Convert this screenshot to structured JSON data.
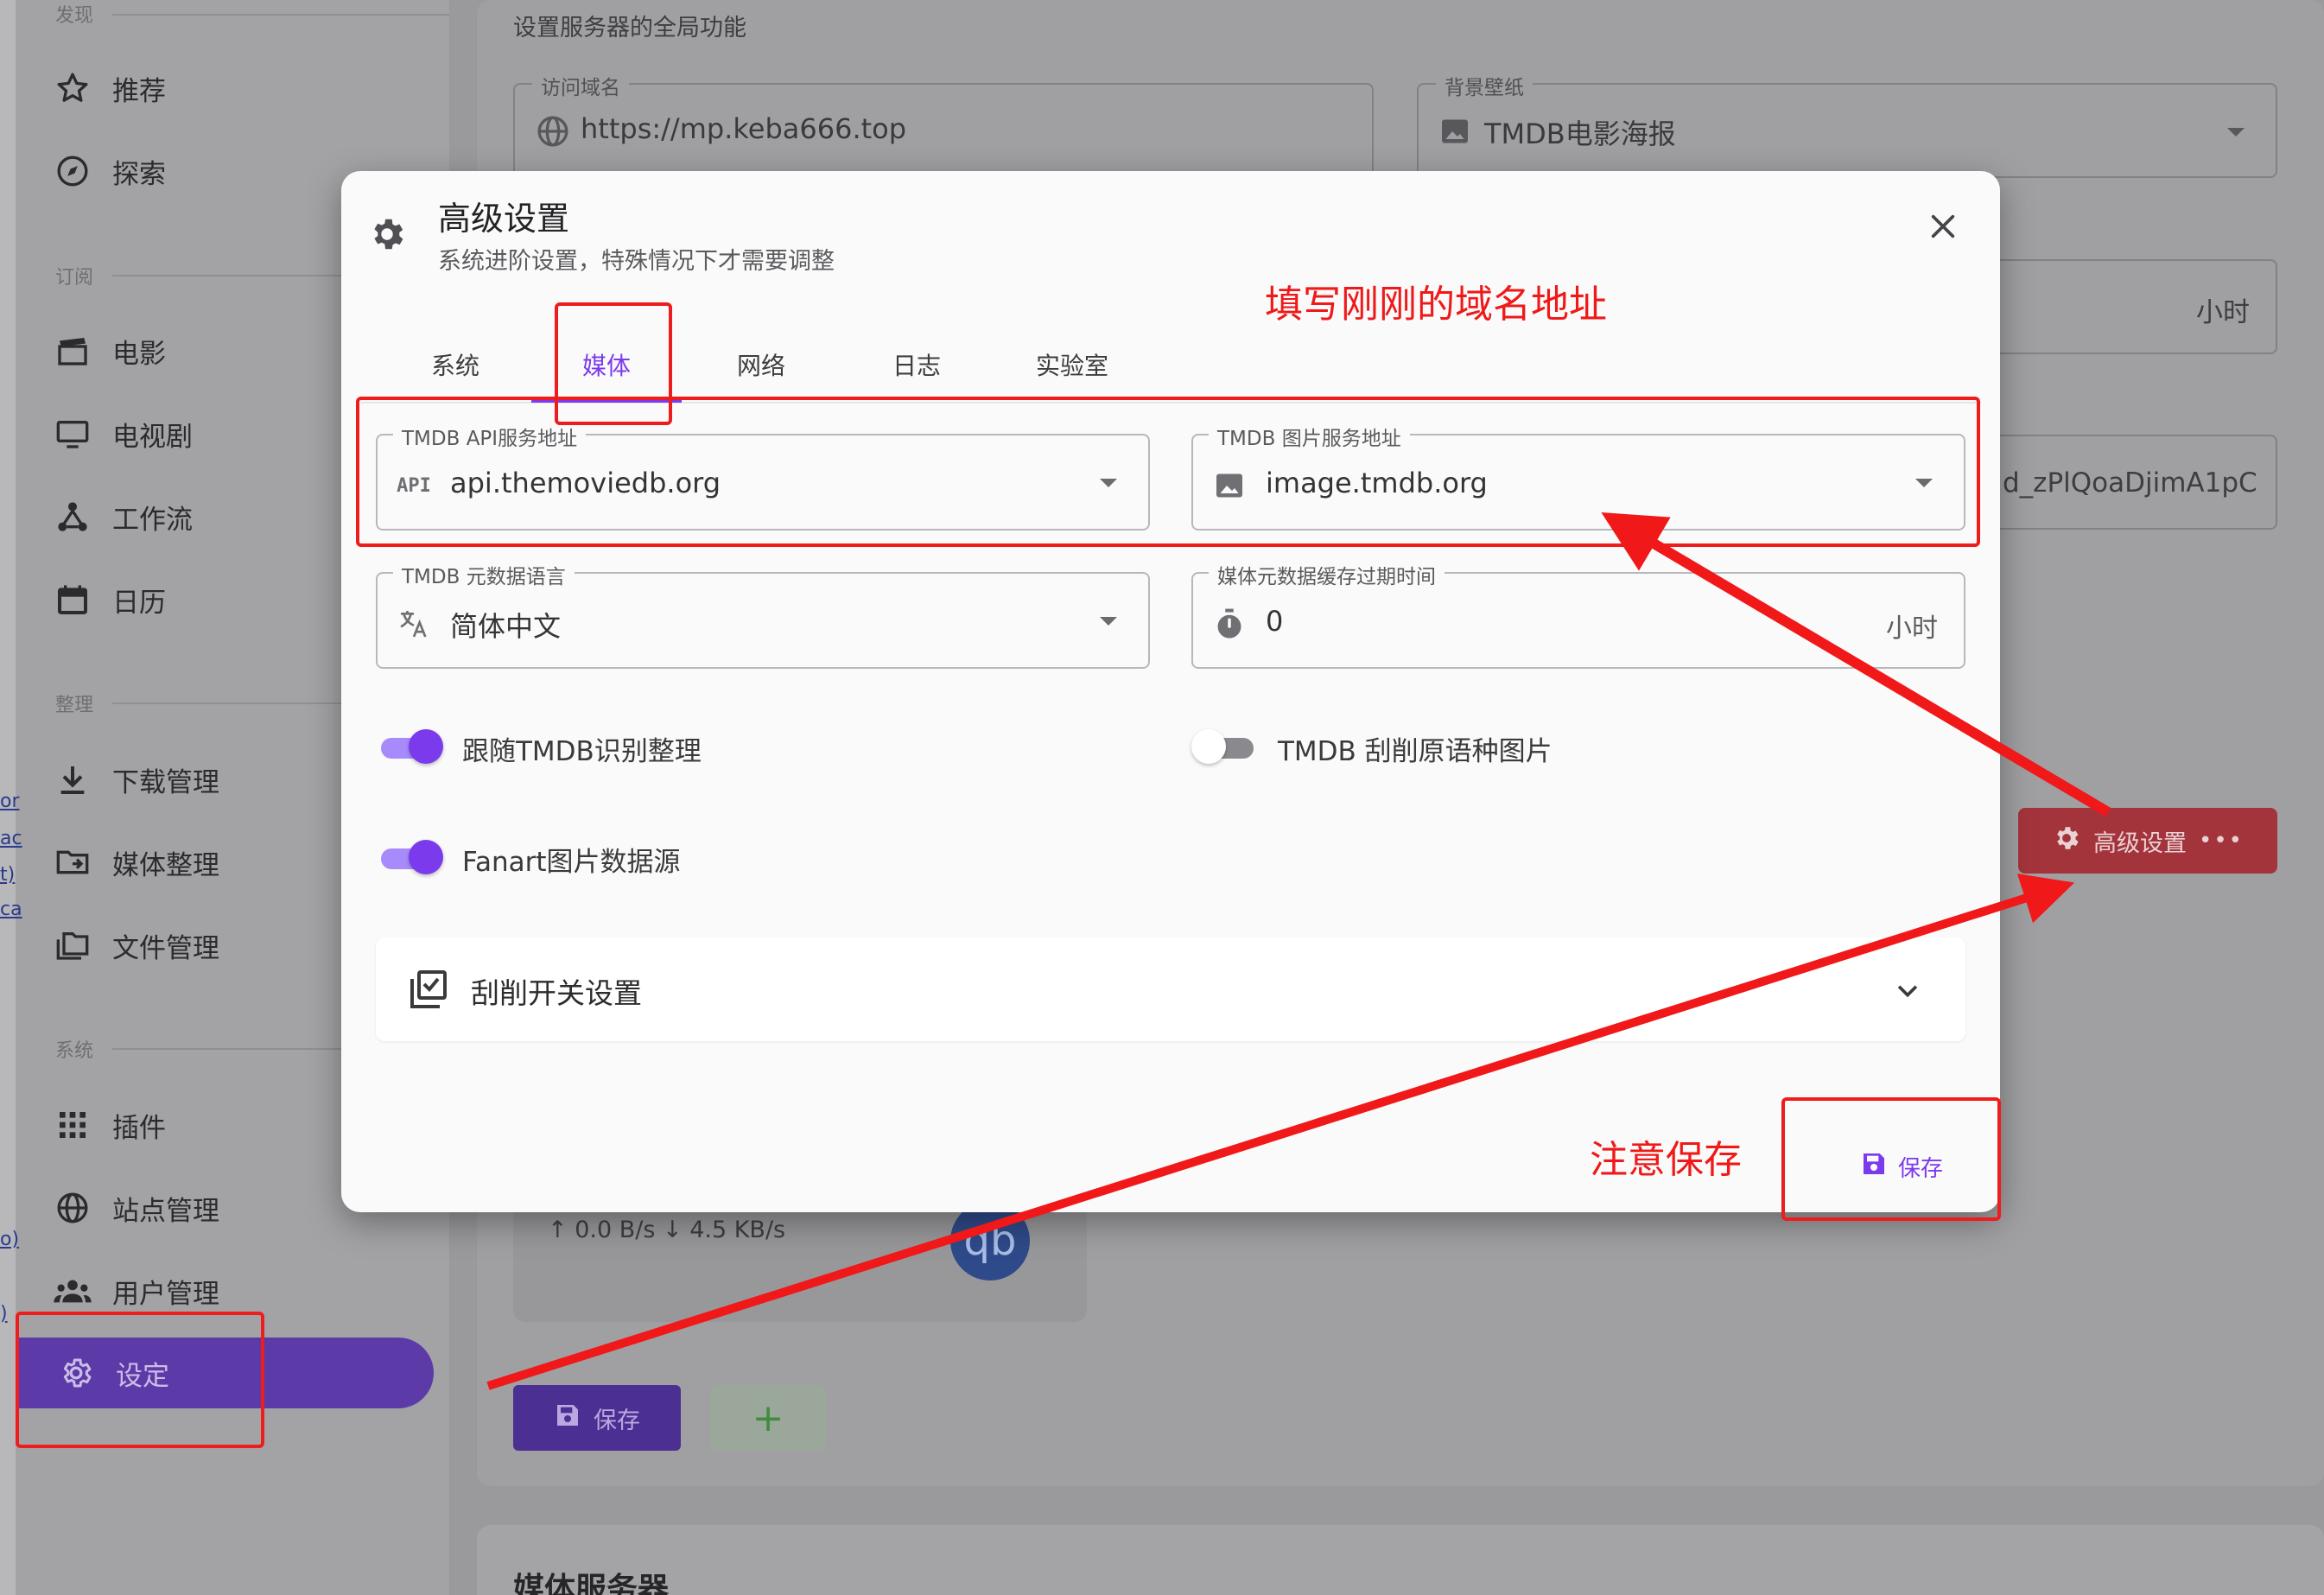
{
  "sidebar": {
    "sections": {
      "discover": "发现",
      "subscribe": "订阅",
      "organize": "整理",
      "system": "系统"
    },
    "items": [
      {
        "label": "推荐",
        "icon": "star-icon"
      },
      {
        "label": "探索",
        "icon": "compass-icon"
      },
      {
        "label": "电影",
        "icon": "clapperboard-icon"
      },
      {
        "label": "电视剧",
        "icon": "tv-icon"
      },
      {
        "label": "工作流",
        "icon": "workflow-icon"
      },
      {
        "label": "日历",
        "icon": "calendar-icon"
      },
      {
        "label": "下载管理",
        "icon": "download-icon"
      },
      {
        "label": "媒体整理",
        "icon": "folder-move-icon"
      },
      {
        "label": "文件管理",
        "icon": "folders-icon"
      },
      {
        "label": "插件",
        "icon": "grid-icon"
      },
      {
        "label": "站点管理",
        "icon": "globe-icon"
      },
      {
        "label": "用户管理",
        "icon": "users-icon"
      },
      {
        "label": "设定",
        "icon": "gear-icon",
        "active": true
      }
    ]
  },
  "background": {
    "section_subtitle": "设置服务器的全局功能",
    "access_domain": {
      "label": "访问域名",
      "value": "https://mp.keba666.top"
    },
    "wallpaper": {
      "label": "背景壁纸",
      "value": "TMDB电影海报"
    },
    "hours_suffix": "小时",
    "partial_key": "d_zPlQoaDjimA1pC",
    "advanced_button": "高级设置",
    "speed_text": "↑ 0.0 B/s  ↓ 4.5 KB/s",
    "qb_logo": "qb",
    "save_button": "保存",
    "add_button": "+",
    "media_server_title": "媒体服务器"
  },
  "dialog": {
    "title": "高级设置",
    "subtitle": "系统进阶设置，特殊情况下才需要调整",
    "tabs": [
      "系统",
      "媒体",
      "网络",
      "日志",
      "实验室"
    ],
    "active_tab": 1,
    "fields": {
      "tmdb_api": {
        "label": "TMDB API服务地址",
        "value": "api.themoviedb.org",
        "icon_text": "API"
      },
      "tmdb_image": {
        "label": "TMDB 图片服务地址",
        "value": "image.tmdb.org"
      },
      "tmdb_lang": {
        "label": "TMDB 元数据语言",
        "value": "简体中文"
      },
      "cache_expire": {
        "label": "媒体元数据缓存过期时间",
        "value": "0",
        "suffix": "小时"
      }
    },
    "switches": [
      {
        "label": "跟随TMDB识别整理",
        "on": true
      },
      {
        "label": "TMDB 刮削原语种图片",
        "on": false
      },
      {
        "label": "Fanart图片数据源",
        "on": true
      }
    ],
    "scrape_panel_title": "刮削开关设置",
    "save_label": "保存"
  },
  "annotations": {
    "fill_domain": "填写刚刚的域名地址",
    "remember_save": "注意保存"
  },
  "colors": {
    "accent": "#7c3aed",
    "annotation": "#f01818",
    "danger_button": "#a4343b"
  }
}
